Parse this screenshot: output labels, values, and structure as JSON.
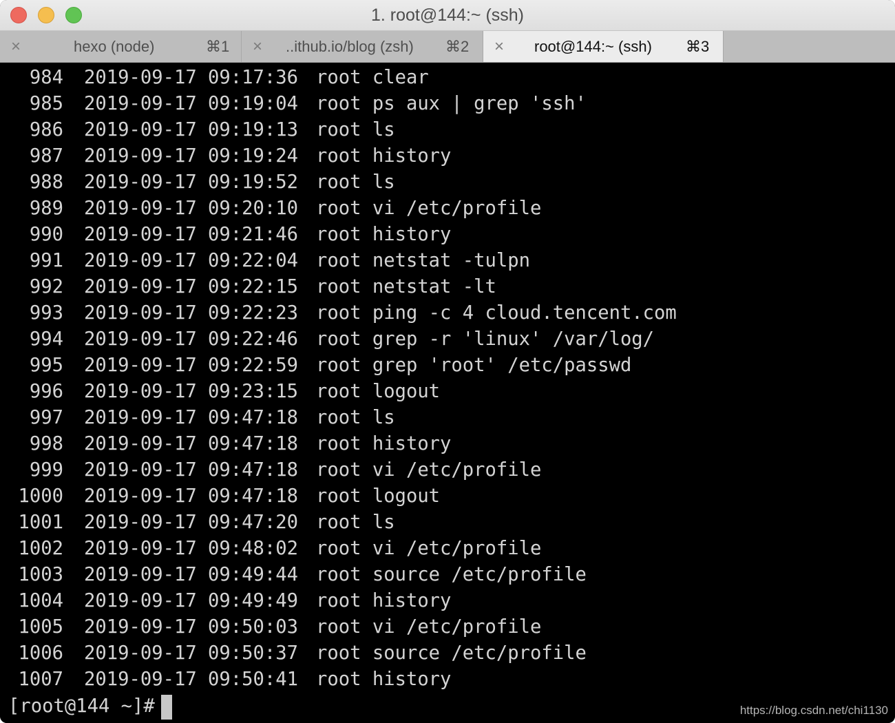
{
  "window": {
    "title": "1. root@144:~ (ssh)"
  },
  "tabs": [
    {
      "label": "hexo (node)",
      "shortcut": "⌘1",
      "close_icon": "×",
      "active": false
    },
    {
      "label": "..ithub.io/blog (zsh)",
      "shortcut": "⌘2",
      "close_icon": "×",
      "active": false
    },
    {
      "label": "root@144:~ (ssh)",
      "shortcut": "⌘3",
      "close_icon": "×",
      "active": true
    }
  ],
  "history": [
    {
      "num": "984",
      "timestamp": "2019-09-17 09:17:36",
      "command": "root clear"
    },
    {
      "num": "985",
      "timestamp": "2019-09-17 09:19:04",
      "command": "root ps aux | grep 'ssh'"
    },
    {
      "num": "986",
      "timestamp": "2019-09-17 09:19:13",
      "command": "root ls"
    },
    {
      "num": "987",
      "timestamp": "2019-09-17 09:19:24",
      "command": "root history"
    },
    {
      "num": "988",
      "timestamp": "2019-09-17 09:19:52",
      "command": "root ls"
    },
    {
      "num": "989",
      "timestamp": "2019-09-17 09:20:10",
      "command": "root vi /etc/profile"
    },
    {
      "num": "990",
      "timestamp": "2019-09-17 09:21:46",
      "command": "root history"
    },
    {
      "num": "991",
      "timestamp": "2019-09-17 09:22:04",
      "command": "root netstat -tulpn"
    },
    {
      "num": "992",
      "timestamp": "2019-09-17 09:22:15",
      "command": "root netstat -lt"
    },
    {
      "num": "993",
      "timestamp": "2019-09-17 09:22:23",
      "command": "root ping -c 4 cloud.tencent.com"
    },
    {
      "num": "994",
      "timestamp": "2019-09-17 09:22:46",
      "command": "root grep -r 'linux' /var/log/"
    },
    {
      "num": "995",
      "timestamp": "2019-09-17 09:22:59",
      "command": "root grep 'root' /etc/passwd"
    },
    {
      "num": "996",
      "timestamp": "2019-09-17 09:23:15",
      "command": "root logout"
    },
    {
      "num": "997",
      "timestamp": "2019-09-17 09:47:18",
      "command": "root ls"
    },
    {
      "num": "998",
      "timestamp": "2019-09-17 09:47:18",
      "command": "root history"
    },
    {
      "num": "999",
      "timestamp": "2019-09-17 09:47:18",
      "command": "root vi /etc/profile"
    },
    {
      "num": "1000",
      "timestamp": "2019-09-17 09:47:18",
      "command": "root logout"
    },
    {
      "num": "1001",
      "timestamp": "2019-09-17 09:47:20",
      "command": "root ls"
    },
    {
      "num": "1002",
      "timestamp": "2019-09-17 09:48:02",
      "command": "root vi /etc/profile"
    },
    {
      "num": "1003",
      "timestamp": "2019-09-17 09:49:44",
      "command": "root source /etc/profile"
    },
    {
      "num": "1004",
      "timestamp": "2019-09-17 09:49:49",
      "command": "root history"
    },
    {
      "num": "1005",
      "timestamp": "2019-09-17 09:50:03",
      "command": "root vi /etc/profile"
    },
    {
      "num": "1006",
      "timestamp": "2019-09-17 09:50:37",
      "command": "root source /etc/profile"
    },
    {
      "num": "1007",
      "timestamp": "2019-09-17 09:50:41",
      "command": "root history"
    }
  ],
  "prompt": "[root@144 ~]#",
  "watermark": "https://blog.csdn.net/chi1130",
  "colors": {
    "terminal_bg": "#000000",
    "terminal_fg": "#d4d4d4",
    "traffic_close": "#ee6a5f",
    "traffic_minimize": "#f5be4f",
    "traffic_maximize": "#61c454",
    "active_tab_bg": "#ececec",
    "inactive_tab_bg": "#bdbdbd"
  }
}
